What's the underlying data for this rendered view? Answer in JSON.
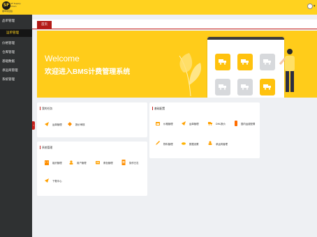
{
  "header": {
    "logo_mark": "SF",
    "logo_text": "SF Supply Chain",
    "logo_sub": "顺丰供应链"
  },
  "sidebar": {
    "items": [
      {
        "label": "品单管理",
        "active": false
      },
      {
        "label": "运单管理",
        "active": true
      },
      {
        "label": "价格管理",
        "active": false
      },
      {
        "label": "仓库管理",
        "active": false
      },
      {
        "label": "基础数据",
        "active": false
      },
      {
        "label": "承运商管理",
        "active": false
      },
      {
        "label": "系统管理",
        "active": false
      }
    ]
  },
  "tabs": [
    {
      "label": "首页"
    }
  ],
  "banner": {
    "title": "Welcome",
    "subtitle": "欢迎进入BMS计费管理系统"
  },
  "panels": {
    "shortcuts": {
      "title": "我的任务",
      "links": [
        {
          "label": "运单管理",
          "icon": "send-icon"
        },
        {
          "label": "报价审核",
          "icon": "diamond-icon"
        }
      ]
    },
    "basic": {
      "title": "基础配置",
      "links": [
        {
          "label": "价格管理",
          "icon": "calendar-icon"
        },
        {
          "label": "运单管理",
          "icon": "send-icon"
        },
        {
          "label": "DHL报价",
          "icon": "truck-icon"
        },
        {
          "label": "国内运费配置",
          "icon": "phone-icon"
        },
        {
          "label": "物料管理",
          "icon": "pen-icon"
        },
        {
          "label": "数据设置",
          "icon": "cloud-icon"
        },
        {
          "label": "承运商管理",
          "icon": "group-icon"
        }
      ]
    },
    "system": {
      "title": "系统管理",
      "links": [
        {
          "label": "组织管理",
          "icon": "building-icon"
        },
        {
          "label": "用户管理",
          "icon": "user-icon"
        },
        {
          "label": "角色管理",
          "icon": "card-icon"
        },
        {
          "label": "操作日志",
          "icon": "doc-icon"
        },
        {
          "label": "下载中心",
          "icon": "send-icon"
        }
      ]
    }
  },
  "colors": {
    "brand": "#ffd21f",
    "accent": "#c8201b",
    "sidebar": "#2f3132"
  }
}
